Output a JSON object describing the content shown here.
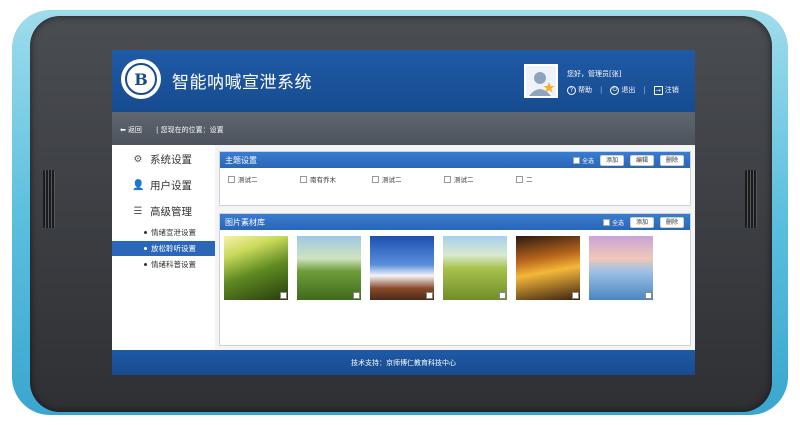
{
  "header": {
    "app_title": "智能呐喊宣泄系统",
    "greeting": "您好，管理员[张]",
    "help": "帮助",
    "logout": "退出",
    "signout": "注销"
  },
  "breadcrumb": {
    "back": "返回",
    "path": "您现在的位置：设置"
  },
  "sidebar": {
    "items": [
      {
        "label": "系统设置",
        "icon": "gear-icon"
      },
      {
        "label": "用户设置",
        "icon": "user-icon"
      },
      {
        "label": "高级管理",
        "icon": "list-icon"
      }
    ],
    "sub_items": [
      {
        "label": "情绪宣泄设置"
      },
      {
        "label": "放松聆听设置",
        "active": true
      },
      {
        "label": "情绪科普设置"
      }
    ]
  },
  "topics_panel": {
    "title": "主题设置",
    "select_all": "全选",
    "add": "添加",
    "edit": "编辑",
    "delete": "删除",
    "topics": [
      "测试二",
      "南有乔木",
      "测试二",
      "测试二",
      "二"
    ]
  },
  "images_panel": {
    "title": "图片素材库",
    "select_all": "全选",
    "add": "添加",
    "delete": "删除",
    "images": [
      {
        "name": "forest-sunlight"
      },
      {
        "name": "green-hills"
      },
      {
        "name": "snowy-mountain"
      },
      {
        "name": "grass-field"
      },
      {
        "name": "autumn-sunset"
      },
      {
        "name": "sea-horizon"
      }
    ]
  },
  "footer": {
    "text": "技术支持：京师博仁教育科技中心"
  },
  "colors": {
    "header_blue": "#1f5aa6",
    "panel_blue": "#2a66b6",
    "active_blue": "#2a67b8",
    "breadcrumb_gray": "#5e6670",
    "device_cyan": "#5cc0de"
  }
}
